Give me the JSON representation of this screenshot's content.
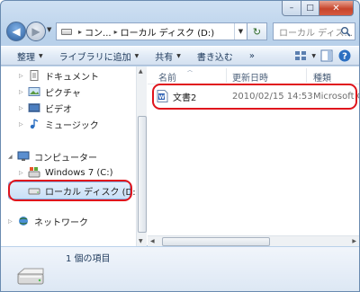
{
  "window": {
    "minimize_glyph": "–",
    "maximize_glyph": "□",
    "close_glyph": "✕"
  },
  "navigation": {
    "back_glyph": "◀",
    "forward_glyph": "▶",
    "address_segments": [
      "コン...",
      "ローカル ディスク (D:)"
    ],
    "address_separator": "▸",
    "refresh_glyph": "↻",
    "search_placeholder": "ローカル ディス..."
  },
  "toolbar": {
    "items": [
      {
        "label": "整理",
        "dropdown": true
      },
      {
        "label": "ライブラリに追加",
        "dropdown": true
      },
      {
        "label": "共有",
        "dropdown": true
      },
      {
        "label": "書き込む",
        "dropdown": false
      },
      {
        "label": "»",
        "dropdown": false
      }
    ],
    "help_glyph": "?"
  },
  "sidebar": {
    "items": [
      {
        "label": "ドキュメント",
        "icon": "document-library-icon"
      },
      {
        "label": "ピクチャ",
        "icon": "pictures-library-icon"
      },
      {
        "label": "ビデオ",
        "icon": "videos-library-icon"
      },
      {
        "label": "ミュージック",
        "icon": "music-library-icon"
      },
      {
        "label": "コンピューター",
        "icon": "computer-icon"
      },
      {
        "label": "Windows 7 (C:)",
        "icon": "windows-drive-icon"
      },
      {
        "label": "ローカル ディスク (D:)",
        "icon": "local-disk-icon"
      },
      {
        "label": "ネットワーク",
        "icon": "network-icon"
      }
    ],
    "selected": "ローカル ディスク (D:)"
  },
  "file_list": {
    "columns": [
      "名前",
      "更新日時",
      "種類"
    ],
    "rows": [
      {
        "name": "文書2",
        "modified": "2010/02/15 14:53",
        "type": "Microsoft O",
        "icon": "word-document-icon"
      }
    ]
  },
  "details_pane": {
    "item_count": "1 個の項目"
  },
  "colors": {
    "highlight_oval": "#e0141c",
    "selection": "#c9e0f7",
    "chrome": "#b9d1ea"
  }
}
